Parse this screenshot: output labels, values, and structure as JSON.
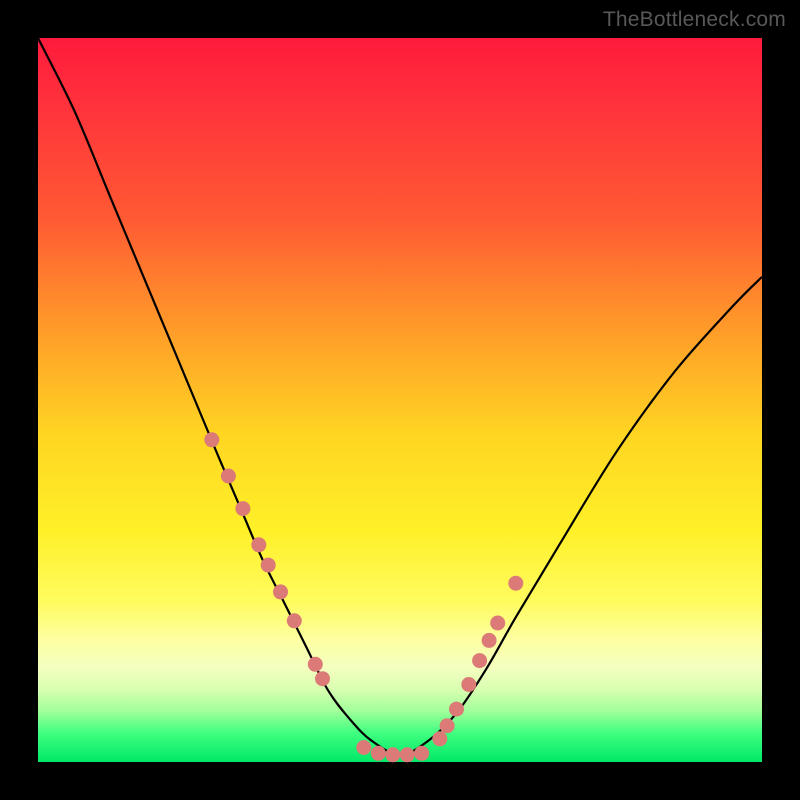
{
  "watermark": "TheBottleneck.com",
  "chart_data": {
    "type": "line",
    "title": "",
    "xlabel": "",
    "ylabel": "",
    "xlim": [
      0,
      1
    ],
    "ylim": [
      0,
      1
    ],
    "series": [
      {
        "name": "bottleneck-curve",
        "x": [
          0.0,
          0.05,
          0.1,
          0.15,
          0.2,
          0.25,
          0.28,
          0.31,
          0.34,
          0.37,
          0.4,
          0.43,
          0.46,
          0.5,
          0.54,
          0.58,
          0.62,
          0.66,
          0.72,
          0.8,
          0.88,
          0.96,
          1.0
        ],
        "y": [
          1.0,
          0.9,
          0.78,
          0.66,
          0.54,
          0.42,
          0.35,
          0.28,
          0.22,
          0.16,
          0.1,
          0.06,
          0.03,
          0.01,
          0.03,
          0.07,
          0.13,
          0.2,
          0.3,
          0.43,
          0.54,
          0.63,
          0.67
        ]
      }
    ],
    "markers": {
      "name": "highlight-points",
      "color": "#dc7a78",
      "x": [
        0.24,
        0.263,
        0.283,
        0.305,
        0.318,
        0.335,
        0.354,
        0.383,
        0.393,
        0.45,
        0.47,
        0.49,
        0.51,
        0.53,
        0.555,
        0.565,
        0.578,
        0.595,
        0.61,
        0.623,
        0.635,
        0.66
      ],
      "y": [
        0.445,
        0.395,
        0.35,
        0.3,
        0.272,
        0.235,
        0.195,
        0.135,
        0.115,
        0.02,
        0.012,
        0.01,
        0.01,
        0.012,
        0.032,
        0.05,
        0.073,
        0.107,
        0.14,
        0.168,
        0.192,
        0.247
      ]
    },
    "background_gradient": {
      "top": "#ff1a3c",
      "mid1": "#ffa328",
      "mid2": "#fff028",
      "bottom": "#00e867"
    }
  }
}
